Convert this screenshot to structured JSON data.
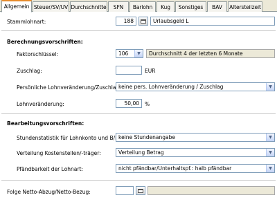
{
  "tabs": [
    {
      "label": "Allgemein"
    },
    {
      "label": "Steuer/SV/UV"
    },
    {
      "label": "Durchschnitte"
    },
    {
      "label": "SFN"
    },
    {
      "label": "Barlohn"
    },
    {
      "label": "Kug"
    },
    {
      "label": "Sonstiges"
    },
    {
      "label": "BAV"
    },
    {
      "label": "Altersteilzeit"
    }
  ],
  "stammlohnart": {
    "label": "Stammlohnart:",
    "number": "188",
    "name": "Urlaubsgeld L"
  },
  "berechnung": {
    "title": "Berechnungsvorschriften:",
    "faktor": {
      "label": "Faktorschlüssel:",
      "value": "106",
      "description": "Durchschnitt 4 der letzten 6 Monate"
    },
    "zuschlag": {
      "label": "Zuschlag:",
      "value": "",
      "unit": "EUR"
    },
    "persoenlich": {
      "label": "Persönliche Lohnveränderung/Zuschlag:",
      "value": "keine pers. Lohnveränderung / Zuschlag"
    },
    "lohnveraenderung": {
      "label": "Lohnveränderung:",
      "value": "50,00",
      "unit": "%"
    }
  },
  "bearbeitung": {
    "title": "Bearbeitungsvorschriften:",
    "stundenstatistik": {
      "label": "Stundenstatistik für Lohnkonto und B/N:",
      "value": "keine Stundenangabe"
    },
    "verteilung": {
      "label": "Verteilung Kostenstellen/-träger:",
      "value": "Verteilung Betrag"
    },
    "pfaendbarkeit": {
      "label": "Pfändbarkeit der Lohnart:",
      "value": "nicht pfändbar/Unterhaltspf.: halb pfändbar"
    }
  },
  "folge": {
    "label": "Folge Netto-Abzug/Netto-Bezug:",
    "number": "",
    "name": ""
  }
}
